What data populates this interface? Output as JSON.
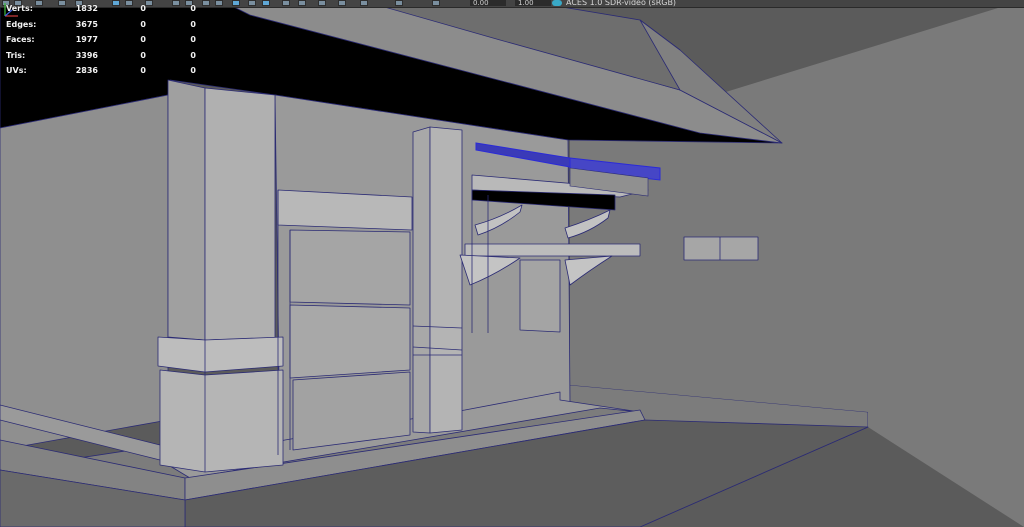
{
  "toolbar": {
    "field_a": "0.00",
    "field_b": "1.00",
    "color_space": "ACES 1.0 SDR-video (sRGB)",
    "icons": [
      "select-tool-icon",
      "lasso-tool-icon",
      "move-tool-icon",
      "rotate-tool-icon",
      "scale-tool-icon",
      "snap-grid-icon",
      "snap-curve-icon",
      "snap-point-icon",
      "render-icon",
      "ipr-render-icon",
      "render-settings-icon",
      "camera-icon",
      "grid-toggle-icon",
      "film-gate-icon",
      "wireframe-icon",
      "shaded-icon",
      "texture-icon",
      "lights-icon",
      "shadows-icon",
      "xray-icon",
      "isolate-icon",
      "color-management-icon"
    ]
  },
  "hud": {
    "rows": [
      {
        "label": "Verts:",
        "total": "1832",
        "selected": "0",
        "uv": "0"
      },
      {
        "label": "Edges:",
        "total": "3675",
        "selected": "0",
        "uv": "0"
      },
      {
        "label": "Faces:",
        "total": "1977",
        "selected": "0",
        "uv": "0"
      },
      {
        "label": "Tris:",
        "total": "3396",
        "selected": "0",
        "uv": "0"
      },
      {
        "label": "UVs:",
        "total": "2836",
        "selected": "0",
        "uv": "0"
      }
    ]
  },
  "colors": {
    "background": "#5b5b5b",
    "wireframe": "#2b2b74",
    "selection": "#2a2ad8",
    "hud_text": "#f2f2f2",
    "axis_x": "#d04040",
    "axis_y": "#40c040",
    "axis_z": "#4060e0"
  }
}
